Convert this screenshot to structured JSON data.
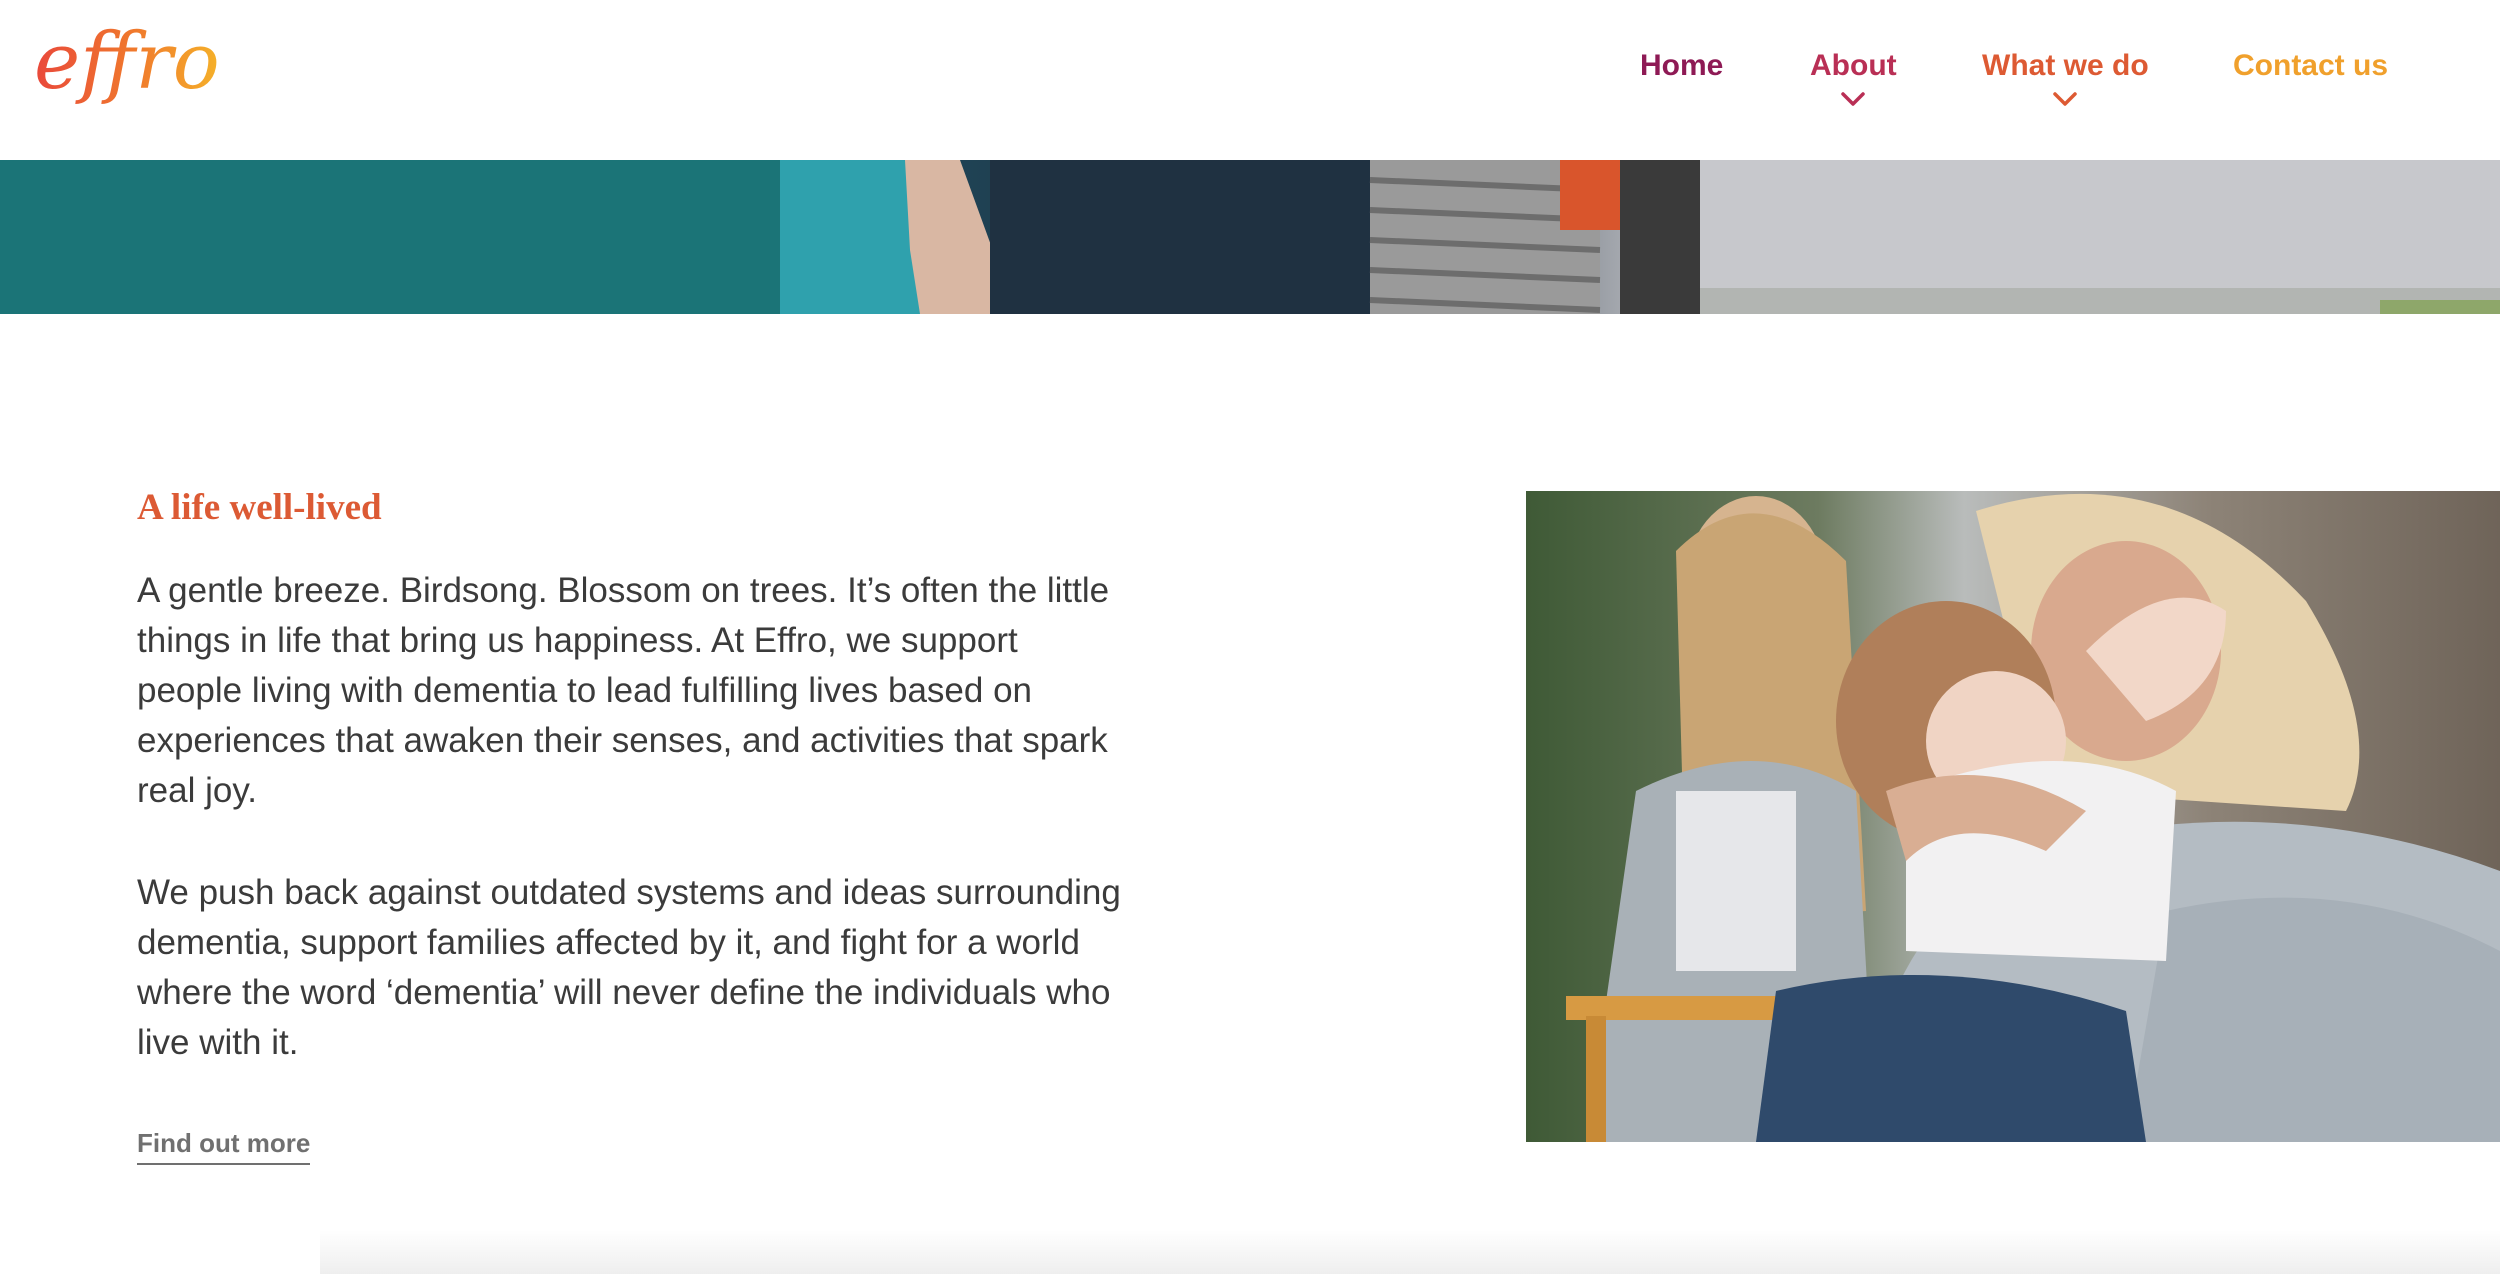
{
  "brand": {
    "logo_text": "effro",
    "logo_colors": [
      "#e9483b",
      "#f07a2c",
      "#f5b12a"
    ]
  },
  "nav": {
    "items": [
      {
        "label": "Home",
        "has_dropdown": false,
        "color": "#8e1a55"
      },
      {
        "label": "About",
        "has_dropdown": true,
        "color": "#b92f55"
      },
      {
        "label": "What we do",
        "has_dropdown": true,
        "color": "#dd5a33"
      },
      {
        "label": "Contact us",
        "has_dropdown": false,
        "color": "#f0a02c"
      }
    ]
  },
  "section": {
    "title": "A life well-lived",
    "paragraph1": "A gentle breeze. Birdsong. Blossom on trees. It’s often the little things in life that bring us happiness. At Effro, we support people living with dementia to lead fulfilling lives based on experiences that awaken their senses, and activities that spark real joy.",
    "paragraph2": "We push back against outdated systems and ideas surrounding dementia, support families affected by it, and fight for a world where the word ‘dementia’ will never define the individuals who live with it.",
    "cta_label": "Find out more"
  },
  "images": {
    "hero": "hero-photo-people-seated",
    "feature": "grandmother-hugging-child-photo"
  },
  "colors": {
    "heading": "#dc5a34",
    "body_text": "#3b3b3b",
    "link": "#707070"
  }
}
